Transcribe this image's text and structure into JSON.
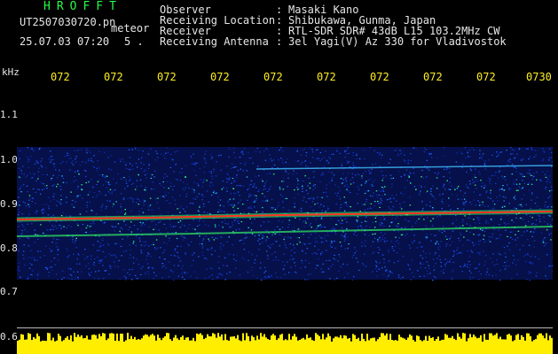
{
  "header": {
    "brand": "HROFFT",
    "filename": "UT2507030720.pn",
    "mode": "meteor",
    "datetime": "25.07.03 07:20",
    "count": "5 ."
  },
  "meta": {
    "rows": [
      {
        "key": "Observer",
        "sep": ":",
        "value": "Masaki Kano"
      },
      {
        "key": "Receiving Location",
        "sep": ":",
        "value": "Shibukawa, Gunma, Japan"
      },
      {
        "key": "Receiver",
        "sep": ":",
        "value": "RTL-SDR SDR# 43dB L15 103.2MHz CW"
      },
      {
        "key": "Receiving Antenna",
        "sep": ":",
        "value": "3el Yagi(V) Az 330 for Vladivostok"
      }
    ]
  },
  "axis": {
    "unit": "kHz",
    "ticks": [
      "1.1",
      "1.0",
      "0.9",
      "0.8",
      "0.7",
      "0.6"
    ]
  },
  "time_labels": [
    "072",
    "072",
    "072",
    "072",
    "072",
    "072",
    "072",
    "072",
    "072",
    "0730"
  ],
  "colors": {
    "background": "#000000",
    "brand": "#22ff44",
    "time_labels": "#ffee22",
    "signal_strong": "#ff3322",
    "signal_mid": "#33ff66",
    "noise": "#1030c0",
    "level_bar": "#ffee00"
  }
}
